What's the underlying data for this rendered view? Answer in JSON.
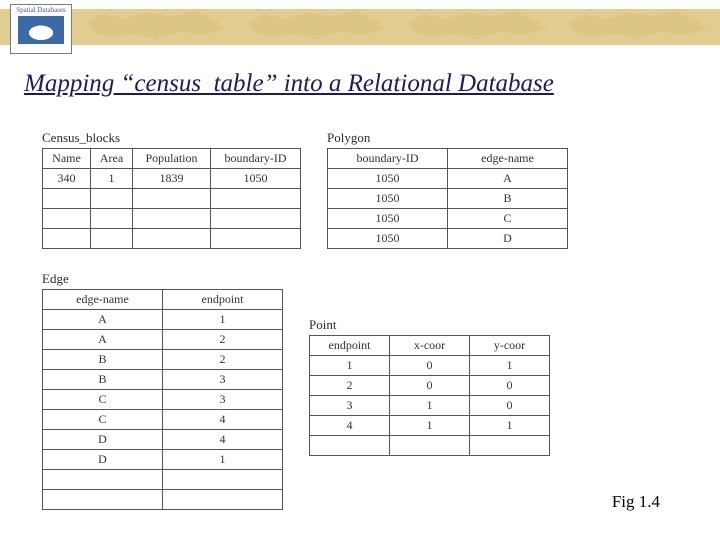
{
  "logo_text": "Spatial Databases",
  "title": "Mapping “census_table” into a Relational Database",
  "caption": "Fig 1.4",
  "census_blocks": {
    "label": "Census_blocks",
    "headers": [
      "Name",
      "Area",
      "Population",
      "boundary-ID"
    ],
    "rows": [
      [
        "340",
        "1",
        "1839",
        "1050"
      ]
    ],
    "empty_rows": 3
  },
  "polygon": {
    "label": "Polygon",
    "headers": [
      "boundary-ID",
      "edge-name"
    ],
    "rows": [
      [
        "1050",
        "A"
      ],
      [
        "1050",
        "B"
      ],
      [
        "1050",
        "C"
      ],
      [
        "1050",
        "D"
      ]
    ],
    "empty_rows": 0
  },
  "edge": {
    "label": "Edge",
    "headers": [
      "edge-name",
      "endpoint"
    ],
    "rows": [
      [
        "A",
        "1"
      ],
      [
        "A",
        "2"
      ],
      [
        "B",
        "2"
      ],
      [
        "B",
        "3"
      ],
      [
        "C",
        "3"
      ],
      [
        "C",
        "4"
      ],
      [
        "D",
        "4"
      ],
      [
        "D",
        "1"
      ]
    ],
    "empty_rows": 2
  },
  "point": {
    "label": "Point",
    "headers": [
      "endpoint",
      "x-coor",
      "y-coor"
    ],
    "rows": [
      [
        "1",
        "0",
        "1"
      ],
      [
        "2",
        "0",
        "0"
      ],
      [
        "3",
        "1",
        "0"
      ],
      [
        "4",
        "1",
        "1"
      ]
    ],
    "empty_rows": 1
  }
}
